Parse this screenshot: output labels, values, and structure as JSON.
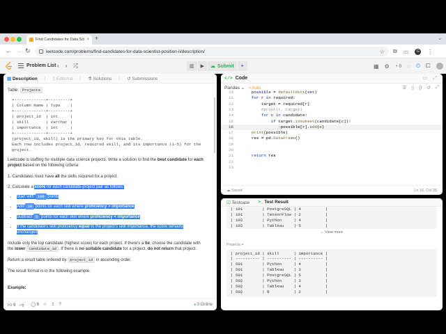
{
  "browser": {
    "tab_title": "Find Candidates for Data Scien",
    "new_tab": "+",
    "url": "leetcode.com/problems/find-candidates-for-data-scientist-position-ii/description/",
    "profile_initial": "G"
  },
  "topnav": {
    "problem_list": "Problem List",
    "submit": "Submit",
    "streak": "0"
  },
  "left": {
    "tabs": {
      "description": "Description",
      "editorial": "Editorial",
      "solutions": "Solutions",
      "submissions": "Submissions"
    },
    "table_label": "Table: ",
    "table_name": "Projects",
    "schema": "+-------------+---------+\n| Column Name | Type    |\n+-------------+---------+\n| project_id  | int     |\n| skill       | varchar |\n| importance  | int     |\n+-------------+---------+\n(project_id, skill) is the primary key for this table.\nEach row includes project_id, required skill, and its importance (1-5) for the\nproject.",
    "intro_a": "Leetcode is staffing for multiple data science projects. Write a solution to find the ",
    "intro_b": "best candidate",
    "intro_c": " for ",
    "intro_d": "each project",
    "intro_e": " based on the following criteria:",
    "c1_a": "1. Candidates must have ",
    "c1_b": "all",
    "c1_c": " the skills required for a project.",
    "c2_a": "2. Calculate a ",
    "c2_b": "score",
    "c2_c": " for each candidate-project pair as follows:",
    "b1_a": "Start with ",
    "b1_b": "100",
    "b1_c": " points",
    "b2_a": "Add ",
    "b2_b": "10",
    "b2_c": " points for each skill where ",
    "b2_d": "proficiency > importance",
    "b3_a": "Subtract ",
    "b3_b": "5",
    "b3_c": " points for each skill where ",
    "b3_d": "proficiency < importance",
    "b4_a": "If the candidate's skill proficiency ",
    "b4_b": "equal",
    "b4_c": " to the project's skill importance, the score remains",
    "b4_d": "unchanged",
    "p1_a": "Include only the top candidate (highest score) for each project. If there's a ",
    "p1_b": "tie",
    "p1_c": ", choose the candidate with",
    "p1_d": "the ",
    "p1_e": "lower",
    "p1_f": "candidate_id",
    "p1_g": ". If there is ",
    "p1_h": "no suitable candidate",
    "p1_i": " for a project, ",
    "p1_j": "do not return",
    "p1_k": " that project.",
    "p2_a": "Return a result table ordered by ",
    "p2_b": "project_id",
    "p2_c": " in ascending order.",
    "p3": "The result format is in the following example.",
    "example": "Example:",
    "footer": {
      "likes": "9",
      "comments": "6",
      "online": "3 Online"
    }
  },
  "code": {
    "title": "Code",
    "language": "Pandas",
    "auto": "Auto",
    "saved": "Saved",
    "cursor": "Ln 16, Col 35",
    "lines": [
      {
        "n": "10",
        "html": "    <span class=\"vr\">possible</span> = <span class=\"fn\">defaultdict</span>(<span class=\"vr\">set</span>)"
      },
      {
        "n": "11",
        "html": "    <span class=\"kw\">for</span> r <span class=\"kw\">in</span> required:"
      },
      {
        "n": "12",
        "html": "        target = required[r]"
      },
      {
        "n": "13",
        "html": "        <span class=\"cm\">#print(r, target)</span>"
      },
      {
        "n": "14",
        "html": "        <span class=\"kw\">for</span> c <span class=\"kw\">in</span> candidate:"
      },
      {
        "n": "15",
        "html": "            <span class=\"kw\">if</span> target.<span class=\"fn\">issubset</span>(candidate[c]):"
      },
      {
        "n": "16",
        "html": "                possible[r].<span class=\"fn\">add</span>(c)"
      },
      {
        "n": "17",
        "html": "    <span class=\"fn\">print</span>(possible)"
      },
      {
        "n": "18",
        "html": "    res = pd.<span class=\"fn\">DataFrame</span>()"
      },
      {
        "n": "19",
        "html": ""
      },
      {
        "n": "20",
        "html": ""
      },
      {
        "n": "21",
        "html": "    <span class=\"kw\">return</span> res"
      },
      {
        "n": "22",
        "html": ""
      },
      {
        "n": "23",
        "html": ""
      }
    ]
  },
  "test": {
    "tabs": {
      "testcase": "Testcase",
      "result": "Test Result"
    },
    "output_fragment": "| 101        | PostgreSQL | 4          |\n| 101        | TensorFlow | 2          |\n| 102        | Python     | 4          |\n| 102        | Tableau    | 5          |",
    "view_more": "View more",
    "projects_label": "Projects =",
    "projects_table": "| project_id | skill      | importance |\n| ---------- | ---------- | ---------- |\n| 501        | Python     | 4          |\n| 501        | Tableau    | 3          |\n| 501        | PostgreSQL | 5          |\n| 502        | Python     | 3          |\n| 502        | Tableau    | 4          |\n| 502        | R          | 2          |"
  },
  "colors": {
    "highlight": "#2f7ff0",
    "submit_green": "#2db55d",
    "auto_orange": "#f0a020"
  }
}
